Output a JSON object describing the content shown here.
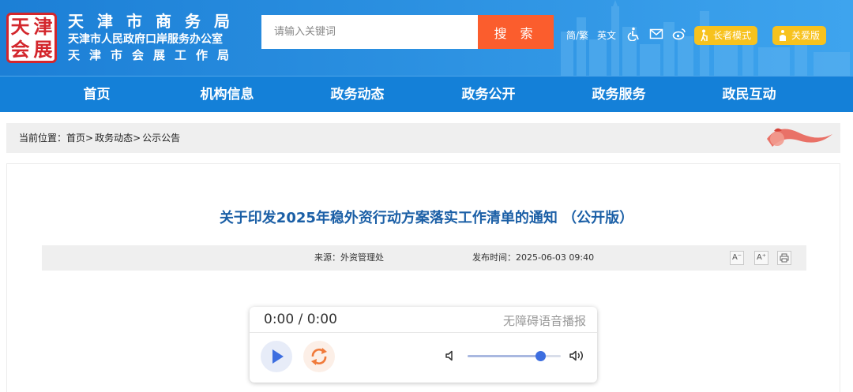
{
  "header": {
    "logo_chars": [
      "天",
      "津",
      "会",
      "展"
    ],
    "brand_line1": "天津市商务局",
    "brand_line2": "天津市人民政府口岸服务办公室",
    "brand_line3": "天津市会展工作局",
    "search_placeholder": "请输入关键词",
    "search_button": "搜 索",
    "lang_simplified_traditional": "简/繁",
    "lang_english": "英文",
    "elder_mode": "长者模式",
    "care_version": "关爱版"
  },
  "nav": {
    "items": [
      "首页",
      "机构信息",
      "政务动态",
      "政务公开",
      "政务服务",
      "政民互动"
    ]
  },
  "breadcrumb": {
    "prefix": "当前位置：",
    "items": [
      "首页>",
      "政务动态>",
      "公示公告"
    ]
  },
  "article": {
    "title": "关于印发2025年稳外资行动方案落实工作清单的通知 （公开版）",
    "source": "来源：外资管理处",
    "publish_time": "发布时间：2025-06-03 09:40",
    "font_decrease": "A⁻",
    "font_increase": "A⁺"
  },
  "player": {
    "time": "0:00 / 0:00",
    "label": "无障碍语音播报",
    "volume": 0.78
  },
  "colors": {
    "header_blue": "#1c7fd6",
    "nav_blue": "#1480d8",
    "search_orange": "#fb5d2d",
    "mode_yellow": "#f7c21e",
    "title_blue": "#1b5fa6",
    "seal_red": "#d3262c"
  },
  "icons": {
    "accessibility": "wheelchair-icon",
    "mail": "mail-icon",
    "weibo": "weibo-icon",
    "elder": "elder-icon",
    "care": "care-icon",
    "print": "print-icon",
    "play": "play-icon",
    "replay": "replay-icon",
    "volume_low": "volume-low-icon",
    "volume_high": "volume-high-icon"
  }
}
